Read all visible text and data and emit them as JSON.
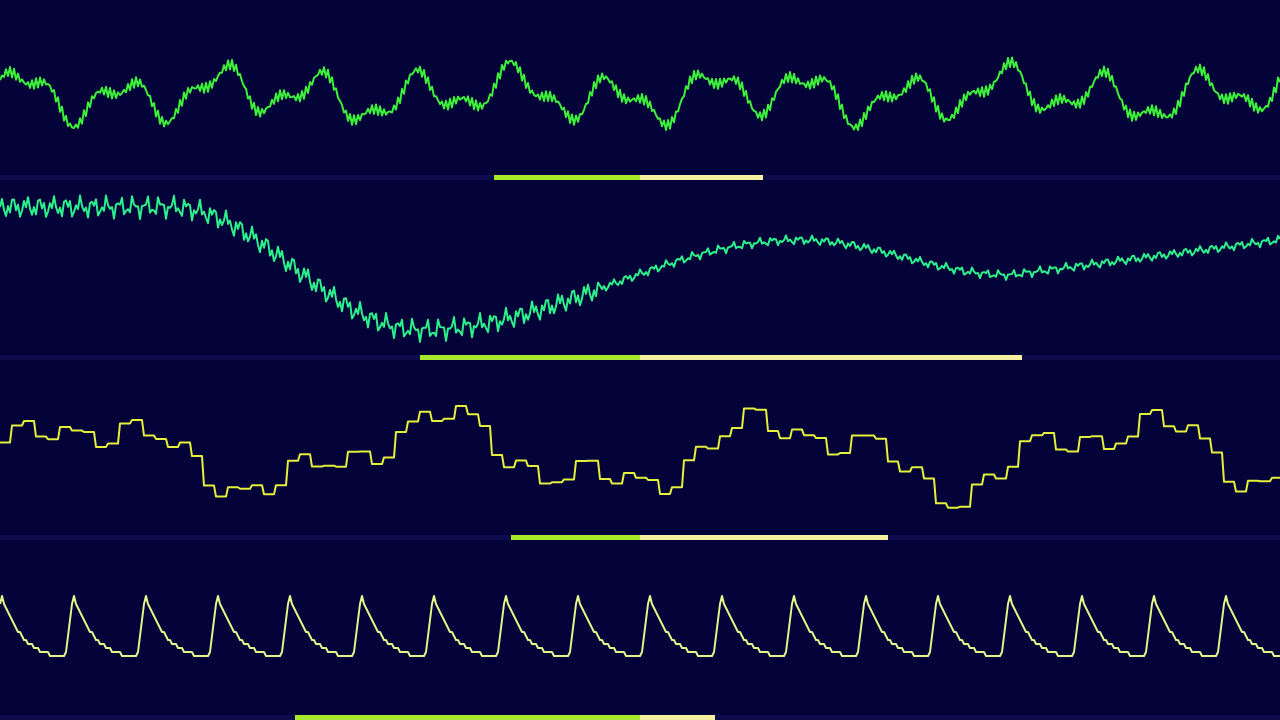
{
  "channels": [
    {
      "color": "#3ef03a",
      "left_meter": {
        "level": 0.228
      },
      "right_meter": {
        "level": 0.192
      }
    },
    {
      "color": "#2ef08a",
      "left_meter": {
        "level": 0.344
      },
      "right_meter": {
        "level": 0.597
      }
    },
    {
      "color": "#e4f03a",
      "left_meter": {
        "level": 0.202
      },
      "right_meter": {
        "level": 0.388
      }
    },
    {
      "color": "#e6f48a",
      "left_meter": {
        "level": 0.539
      },
      "right_meter": {
        "level": 0.117
      }
    }
  ]
}
